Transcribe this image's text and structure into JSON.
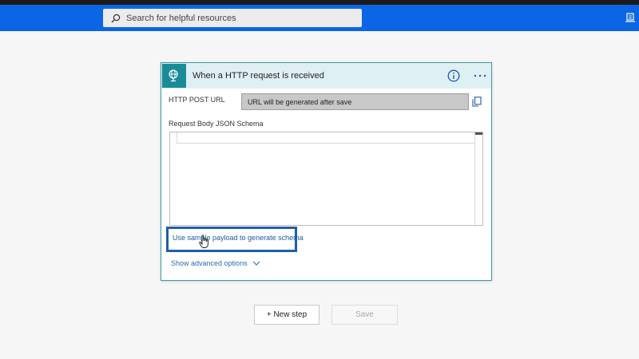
{
  "header": {
    "search_placeholder": "Search for helpful resources",
    "accent": "#0a66e4"
  },
  "card": {
    "title": "When a HTTP request is received",
    "trigger_icon": "globe-request-icon",
    "info_icon": "info-icon",
    "more_icon": "more-options-icon",
    "url_label": "HTTP POST URL",
    "url_value": "URL will be generated after save",
    "schema_label": "Request Body JSON Schema",
    "sample_link": "Use sample payload to generate schema",
    "advanced": "Show advanced options",
    "accent": "#198c98"
  },
  "actions": {
    "new_step": "+ New step",
    "save": "Save"
  }
}
